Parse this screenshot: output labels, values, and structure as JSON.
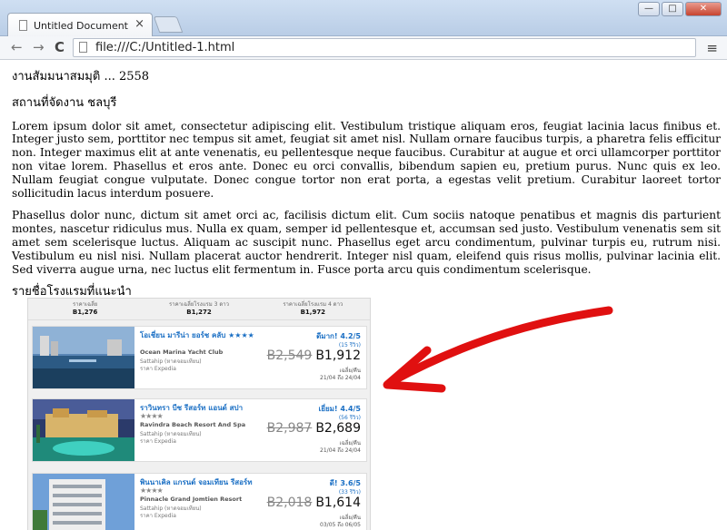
{
  "window": {
    "tab_title": "Untitled Document",
    "tab_close": "×",
    "buttons": {
      "minimize": "—",
      "maximize": "□",
      "close": "✕"
    }
  },
  "toolbar": {
    "back_icon": "←",
    "forward_icon": "→",
    "reload_icon": "C",
    "url": "file:///C:/Untitled-1.html",
    "menu_icon": "≡"
  },
  "page": {
    "line1": "งานสัมมนาสมมุติ ... 2558",
    "line2": "สถานที่จัดงาน ชลบุรี",
    "paragraphs": [
      "Lorem ipsum dolor sit amet, consectetur adipiscing elit. Vestibulum tristique aliquam eros, feugiat lacinia lacus finibus et. Integer justo sem, porttitor nec tempus sit amet, feugiat sit amet nisl. Nullam ornare faucibus turpis, a pharetra felis efficitur non. Integer maximus elit at ante venenatis, eu pellentesque neque faucibus. Curabitur at augue et orci ullamcorper porttitor non vitae lorem. Phasellus et eros ante. Donec eu orci convallis, bibendum sapien eu, pretium purus. Nunc quis ex leo. Nullam feugiat congue vulputate. Donec congue tortor non erat porta, a egestas velit pretium. Curabitur laoreet tortor sollicitudin lacus interdum posuere.",
      "Phasellus dolor nunc, dictum sit amet orci ac, facilisis dictum elit. Cum sociis natoque penatibus et magnis dis parturient montes, nascetur ridiculus mus. Nulla ex quam, semper id pellentesque et, accumsan sed justo. Vestibulum venenatis sem sit amet sem scelerisque luctus. Aliquam ac suscipit nunc. Phasellus eget arcu condimentum, pulvinar turpis eu, rutrum nisi. Vestibulum eu nisl nisi. Nullam placerat auctor hendrerit. Integer nisl quam, eleifend quis risus mollis, pulvinar lacinia elit. Sed viverra augue urna, nec luctus elit fermentum in. Fusce porta arcu quis condimentum scelerisque."
    ],
    "hotels_heading": "รายชื่อโรงแรมที่แนะนำ"
  },
  "widget": {
    "header": [
      {
        "label": "ราคาเฉลี่ย",
        "value": "B1,276"
      },
      {
        "label": "ราคาเฉลี่ยโรงแรม 3 ดาว",
        "value": "B1,272"
      },
      {
        "label": "ราคาเฉลี่ยโรงแรม 4 ดาว",
        "value": "B1,972"
      }
    ],
    "hotels": [
      {
        "name": "โอเชี่ยน มารีน่า ยอร์ช คลับ ★★★★",
        "stars": "",
        "english": "Ocean Marina Yacht Club",
        "location": "Sattahip (หาดจอมเทียน)",
        "source": "ราคา Expedia",
        "rating": "ดีมาก! 4.2/5",
        "reviews": "(15 รีวิว)",
        "old_price": "B2,549",
        "new_price": "B1,912",
        "per": "เฉลี่ย/คืน",
        "dates": "21/04 ถึง 24/04"
      },
      {
        "name": "ราวินทรา บีช รีสอร์ท แอนด์ สปา",
        "stars": "★★★★",
        "english": "Ravindra Beach Resort And Spa",
        "location": "Sattahip (หาดจอมเทียน)",
        "source": "ราคา Expedia",
        "rating": "เยี่ยม! 4.4/5",
        "reviews": "(56 รีวิว)",
        "old_price": "B2,987",
        "new_price": "B2,689",
        "per": "เฉลี่ย/คืน",
        "dates": "21/04 ถึง 24/04"
      },
      {
        "name": "พินนาเคิล แกรนด์ จอมเทียน รีสอร์ท",
        "stars": "★★★★",
        "english": "Pinnacle Grand Jomtien Resort",
        "location": "Sattahip (หาดจอมเทียน)",
        "source": "ราคา Expedia",
        "rating": "ดี! 3.6/5",
        "reviews": "(33 รีวิว)",
        "old_price": "B2,018",
        "new_price": "B1,614",
        "per": "เฉลี่ย/คืน",
        "dates": "03/05 ถึง 06/05"
      }
    ]
  },
  "colors": {
    "link_blue": "#1a6fc4",
    "annotation_red": "#e01010"
  }
}
